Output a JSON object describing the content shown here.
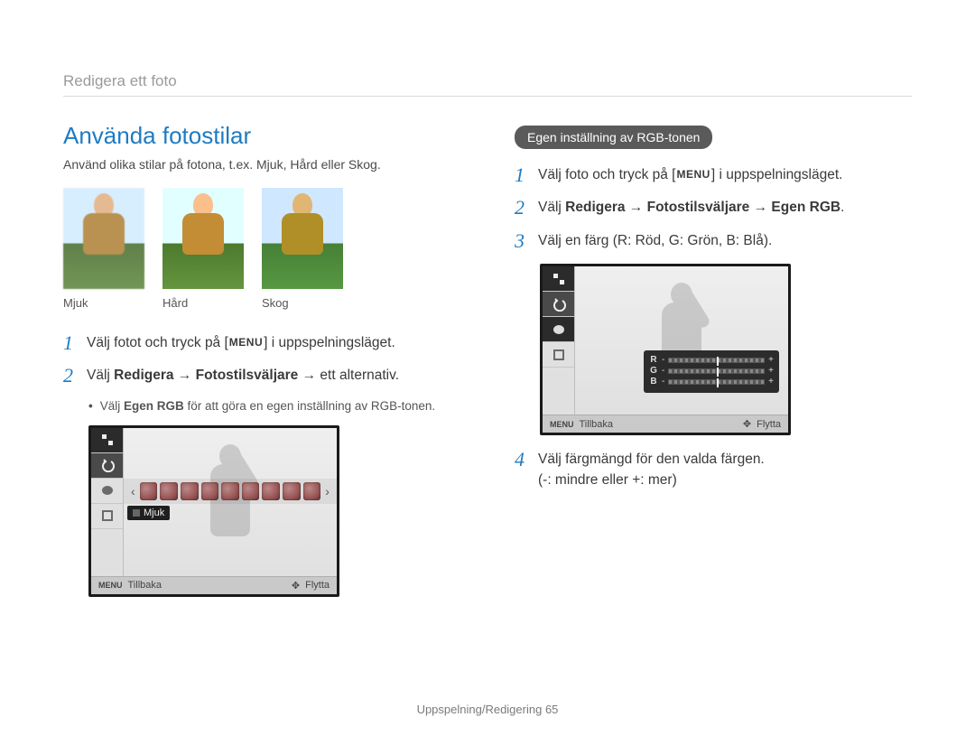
{
  "breadcrumb": "Redigera ett foto",
  "h2": "Använda fotostilar",
  "intro": "Använd olika stilar på fotona, t.ex. Mjuk, Hård eller Skog.",
  "thumbs": {
    "soft": "Mjuk",
    "hard": "Hård",
    "forest": "Skog"
  },
  "left_steps": {
    "s1_pre": "Välj fotot och tryck på [",
    "s1_menu": "MENU",
    "s1_post": "] i uppspelningsläget.",
    "s2_pre": "Välj ",
    "s2_bold": "Redigera → Fotostilsväljare",
    "s2_post": " → ett alternativ.",
    "bullet_pre": "Välj ",
    "bullet_bold": "Egen RGB",
    "bullet_post": " för att göra en egen inställning av RGB-tonen."
  },
  "lcd1": {
    "style_name": "Mjuk",
    "footer_menu": "MENU",
    "footer_back": "Tillbaka",
    "footer_move": "Flytta"
  },
  "right": {
    "pill": "Egen inställning av RGB-tonen",
    "s1_pre": "Välj foto och tryck på [",
    "s1_menu": "MENU",
    "s1_post": "] i uppspelningsläget.",
    "s2_pre": "Välj ",
    "s2_bold": "Redigera → Fotostilsväljare → Egen RGB",
    "s2_post": ".",
    "s3": "Välj en färg (R: Röd, G: Grön, B: Blå).",
    "s4_line1": "Välj färgmängd för den valda färgen.",
    "s4_line2": "(-: mindre eller +: mer)"
  },
  "lcd2": {
    "r": "R",
    "g": "G",
    "b": "B",
    "minus": "-",
    "plus": "+",
    "footer_menu": "MENU",
    "footer_back": "Tillbaka",
    "footer_move": "Flytta"
  },
  "footer": {
    "section": "Uppspelning/Redigering",
    "page": "65"
  }
}
